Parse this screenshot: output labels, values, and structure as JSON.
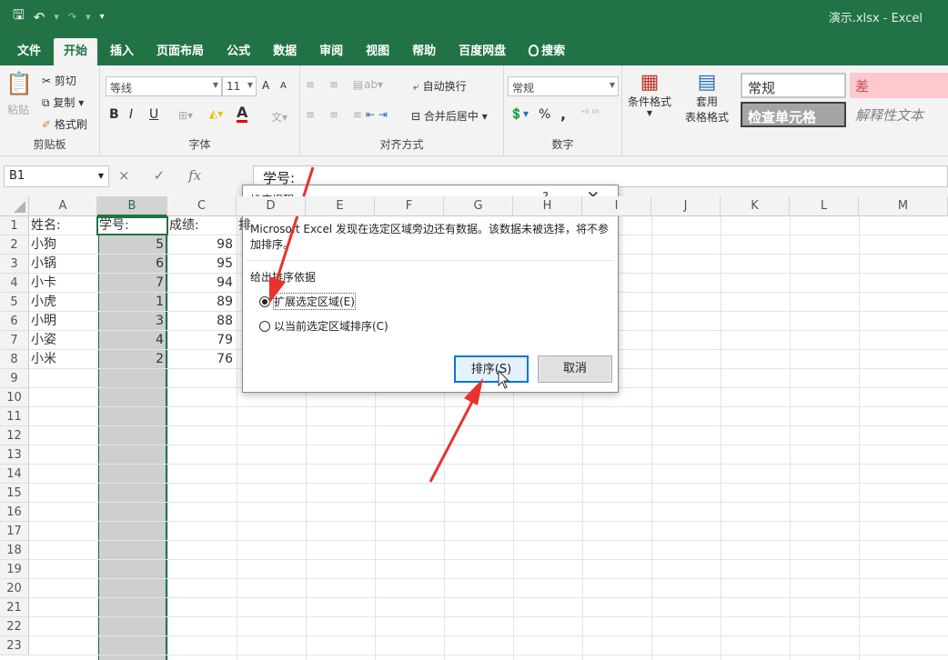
{
  "titlebar": {
    "title": "演示.xlsx  -  Excel"
  },
  "tabs": [
    {
      "label": "文件"
    },
    {
      "label": "开始"
    },
    {
      "label": "插入"
    },
    {
      "label": "页面布局"
    },
    {
      "label": "公式"
    },
    {
      "label": "数据"
    },
    {
      "label": "审阅"
    },
    {
      "label": "视图"
    },
    {
      "label": "帮助"
    },
    {
      "label": "百度网盘"
    },
    {
      "label": "搜索"
    }
  ],
  "ribbon": {
    "clipboard": {
      "paste": "粘贴",
      "cut": "剪切",
      "copy": "复制",
      "format_painter": "格式刷",
      "label": "剪贴板"
    },
    "font": {
      "name": "等线",
      "size": "11",
      "bold": "B",
      "italic": "I",
      "underline": "U",
      "grow": "A",
      "shrink": "A",
      "color": "A",
      "label": "字体"
    },
    "alignment": {
      "wrap": "自动换行",
      "merge": "合并后居中",
      "label": "对齐方式"
    },
    "number": {
      "format": "常规",
      "percent": "%",
      "comma": ",",
      "label": "数字"
    },
    "styles": {
      "conditional": "条件格式",
      "table1": "套用",
      "table2": "表格格式",
      "normal": "常规",
      "bad": "差",
      "check_cell": "检查单元格",
      "explanatory": "解释性文本"
    }
  },
  "formula_bar": {
    "name_box": "B1",
    "cancel": "×",
    "enter": "✓",
    "fx": "fx",
    "content": "学号:"
  },
  "columns": [
    "A",
    "B",
    "C",
    "D",
    "E",
    "F",
    "G",
    "H",
    "I",
    "J",
    "K",
    "L",
    "M"
  ],
  "rows": [
    "1",
    "2",
    "3",
    "4",
    "5",
    "6",
    "7",
    "8",
    "9",
    "10",
    "11",
    "12",
    "13",
    "14",
    "15",
    "16",
    "17",
    "18",
    "19",
    "20",
    "21",
    "22",
    "23"
  ],
  "cells": {
    "A": [
      "姓名:",
      "小狗",
      "小锅",
      "小卡",
      "小虎",
      "小明",
      "小姿",
      "小米"
    ],
    "B": [
      "学号:",
      "5",
      "6",
      "7",
      "1",
      "3",
      "4",
      "2"
    ],
    "C": [
      "成绩:",
      "98",
      "95",
      "94",
      "89",
      "88",
      "79",
      "76"
    ],
    "D1": "排"
  },
  "dialog": {
    "title": "排序提醒",
    "help": "?",
    "close": "✕",
    "message": "Microsoft Excel 发现在选定区域旁边还有数据。该数据未被选择，将不参加排序。",
    "group_label": "给出排序依据",
    "option_expand": "扩展选定区域(E)",
    "option_current": "以当前选定区域排序(C)",
    "sort_button": "排序(S)",
    "cancel_button": "取消"
  },
  "colors": {
    "accent": "#217346",
    "arrow": "#e8322b"
  }
}
